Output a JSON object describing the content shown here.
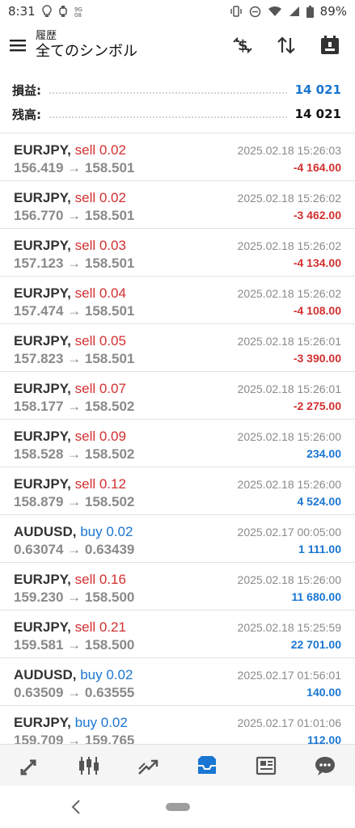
{
  "status_bar": {
    "time": "8:31",
    "battery": "89%",
    "icons_left": [
      "bulb-icon",
      "watch-icon",
      "data-icon"
    ],
    "icons_right": [
      "vibrate-icon",
      "dnd-icon",
      "wifi-icon",
      "signal-icon",
      "battery-icon"
    ]
  },
  "app_bar": {
    "subtitle": "履歴",
    "title": "全てのシンボル",
    "actions": [
      "currency-exchange-icon",
      "sort-icon",
      "calendar-icon"
    ]
  },
  "summary": {
    "profit_label": "損益:",
    "profit_value": "14 021",
    "balance_label": "残高:",
    "balance_value": "14 021"
  },
  "trades": [
    {
      "symbol": "EURJPY,",
      "side": "sell 0.02",
      "side_type": "sell",
      "prices": "156.419 → 158.501",
      "time": "2025.02.18 15:26:03",
      "profit": "-4 164.00",
      "profit_sign": "neg"
    },
    {
      "symbol": "EURJPY,",
      "side": "sell 0.02",
      "side_type": "sell",
      "prices": "156.770 → 158.501",
      "time": "2025.02.18 15:26:02",
      "profit": "-3 462.00",
      "profit_sign": "neg"
    },
    {
      "symbol": "EURJPY,",
      "side": "sell 0.03",
      "side_type": "sell",
      "prices": "157.123 → 158.501",
      "time": "2025.02.18 15:26:02",
      "profit": "-4 134.00",
      "profit_sign": "neg"
    },
    {
      "symbol": "EURJPY,",
      "side": "sell 0.04",
      "side_type": "sell",
      "prices": "157.474 → 158.501",
      "time": "2025.02.18 15:26:02",
      "profit": "-4 108.00",
      "profit_sign": "neg"
    },
    {
      "symbol": "EURJPY,",
      "side": "sell 0.05",
      "side_type": "sell",
      "prices": "157.823 → 158.501",
      "time": "2025.02.18 15:26:01",
      "profit": "-3 390.00",
      "profit_sign": "neg"
    },
    {
      "symbol": "EURJPY,",
      "side": "sell 0.07",
      "side_type": "sell",
      "prices": "158.177 → 158.502",
      "time": "2025.02.18 15:26:01",
      "profit": "-2 275.00",
      "profit_sign": "neg"
    },
    {
      "symbol": "EURJPY,",
      "side": "sell 0.09",
      "side_type": "sell",
      "prices": "158.528 → 158.502",
      "time": "2025.02.18 15:26:00",
      "profit": "234.00",
      "profit_sign": "pos"
    },
    {
      "symbol": "EURJPY,",
      "side": "sell 0.12",
      "side_type": "sell",
      "prices": "158.879 → 158.502",
      "time": "2025.02.18 15:26:00",
      "profit": "4 524.00",
      "profit_sign": "pos"
    },
    {
      "symbol": "AUDUSD,",
      "side": "buy 0.02",
      "side_type": "buy",
      "prices": "0.63074 → 0.63439",
      "time": "2025.02.17 00:05:00",
      "profit": "1 111.00",
      "profit_sign": "pos"
    },
    {
      "symbol": "EURJPY,",
      "side": "sell 0.16",
      "side_type": "sell",
      "prices": "159.230 → 158.500",
      "time": "2025.02.18 15:26:00",
      "profit": "11 680.00",
      "profit_sign": "pos"
    },
    {
      "symbol": "EURJPY,",
      "side": "sell 0.21",
      "side_type": "sell",
      "prices": "159.581 → 158.500",
      "time": "2025.02.18 15:25:59",
      "profit": "22 701.00",
      "profit_sign": "pos"
    },
    {
      "symbol": "AUDUSD,",
      "side": "buy 0.02",
      "side_type": "buy",
      "prices": "0.63509 → 0.63555",
      "time": "2025.02.17 01:56:01",
      "profit": "140.00",
      "profit_sign": "pos"
    },
    {
      "symbol": "EURJPY,",
      "side": "buy 0.02",
      "side_type": "buy",
      "prices": "159.709 → 159.765",
      "time": "2025.02.17 01:01:06",
      "profit": "112.00",
      "profit_sign": "pos"
    }
  ],
  "bottom_nav": {
    "tabs": [
      "quotes-icon",
      "chart-icon",
      "trade-icon",
      "history-icon",
      "news-icon",
      "chat-icon"
    ],
    "active": "history-icon",
    "active_color": "#1976d2",
    "inactive_color": "#555555"
  }
}
